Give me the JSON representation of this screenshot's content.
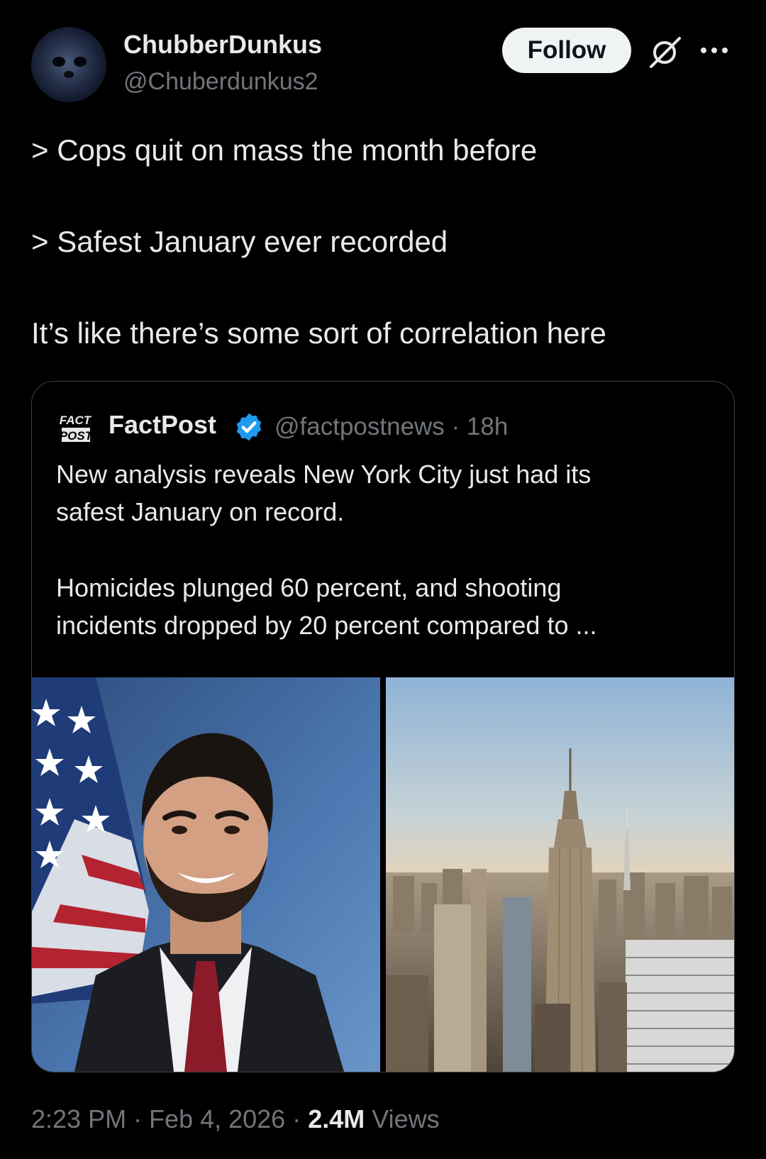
{
  "author": {
    "display_name": "ChubberDunkus",
    "handle": "@Chuberdunkus2",
    "avatar_icon": "seal-avatar"
  },
  "actions": {
    "follow_label": "Follow",
    "grok_icon": "grok-icon",
    "more_icon": "more-icon"
  },
  "tweet": {
    "lines": [
      "> Cops quit on mass the month before",
      "> Safest January ever recorded",
      "It’s like there’s some sort of correlation here"
    ]
  },
  "quote": {
    "logo_text": [
      "FACT",
      "POST"
    ],
    "name": "FactPost",
    "verified_icon": "verified-badge-icon",
    "handle_time": "@factpostnews · 18h",
    "text_lines": [
      "New analysis reveals New York City just had its",
      "safest January on record.",
      "Homicides plunged 60 percent, and shooting",
      "incidents dropped by 20 percent compared to ..."
    ],
    "media": [
      "portrait-photo",
      "skyline-photo"
    ]
  },
  "footer": {
    "time_date": "2:23 PM · Feb 4, 2026 · ",
    "views_count": "2.4M",
    "views_label": " Views"
  },
  "colors": {
    "background": "#000000",
    "text": "#e7e9ea",
    "secondary": "#71767b",
    "verified": "#1d9bf0",
    "follow_bg": "#eff3f4"
  }
}
